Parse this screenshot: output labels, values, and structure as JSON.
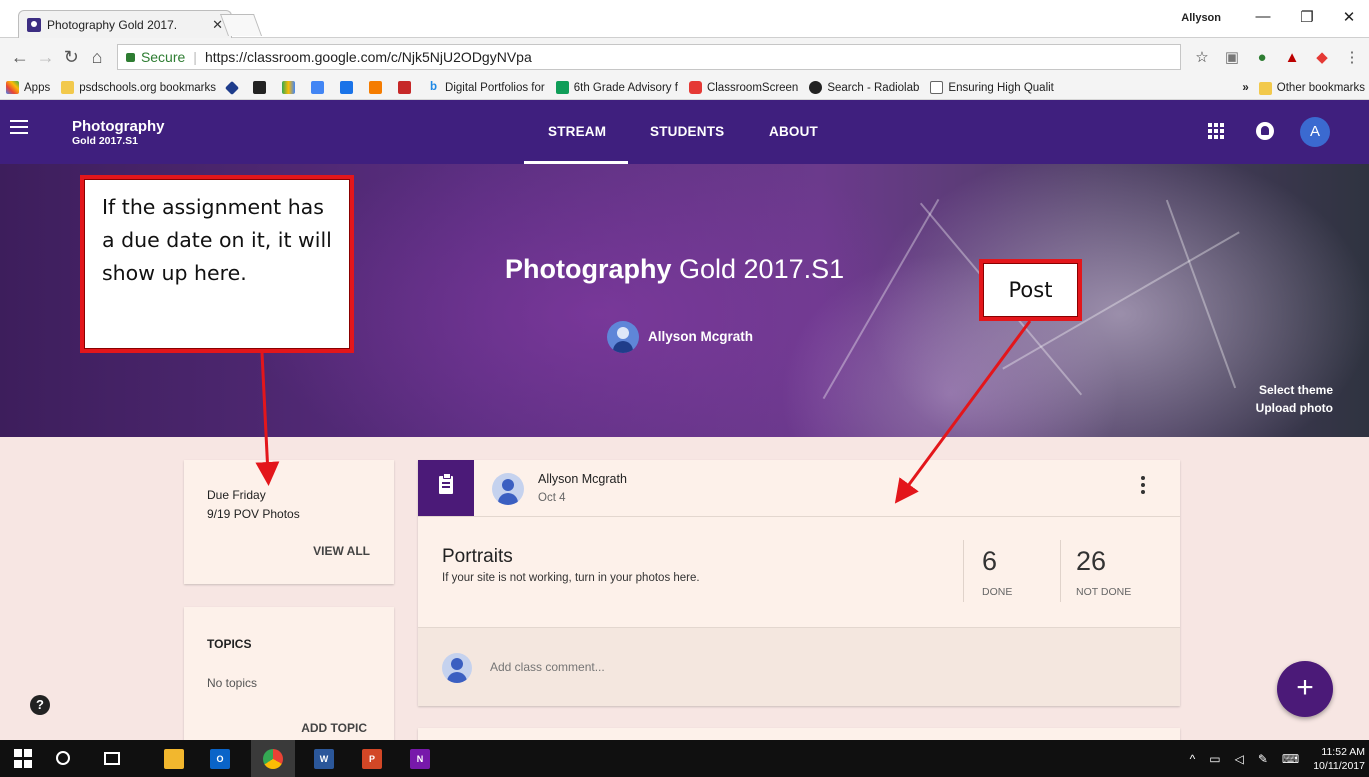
{
  "browser": {
    "tab_title": "Photography Gold 2017.",
    "user": "Allyson",
    "secure_label": "Secure",
    "url": "https://classroom.google.com/c/Njk5NjU2ODgyNVpa",
    "bookmarks": [
      "Apps",
      "psdschools.org bookmarks",
      "Digital Portfolios for",
      "6th Grade Advisory f",
      "ClassroomScreen",
      "Search - Radiolab",
      "Ensuring High Qualit"
    ],
    "more_bookmarks": "»",
    "other_bookmarks": "Other bookmarks"
  },
  "header": {
    "class_name": "Photography",
    "class_section": "Gold 2017.S1",
    "tabs": [
      "STREAM",
      "STUDENTS",
      "ABOUT"
    ],
    "active_tab": "STREAM",
    "avatar_initial": "A"
  },
  "banner": {
    "title_bold": "Photography",
    "title_rest": " Gold 2017.S1",
    "teacher": "Allyson Mcgrath",
    "select_theme": "Select theme",
    "upload_photo": "Upload photo"
  },
  "annotations": {
    "due_callout": "If the assignment has a due date on it, it will show up here.",
    "post_callout": "Post",
    "border_color": "#e3161b"
  },
  "upcoming": {
    "due_label": "Due Friday",
    "due_item": "9/19 POV Photos",
    "view_all": "VIEW ALL"
  },
  "topics": {
    "title": "TOPICS",
    "empty": "No topics",
    "add": "ADD TOPIC"
  },
  "post": {
    "author": "Allyson Mcgrath",
    "date": "Oct 4",
    "title": "Portraits",
    "description": "If your site is not working, turn in your photos here.",
    "done_count": "6",
    "done_label": "DONE",
    "not_done_count": "26",
    "not_done_label": "NOT DONE",
    "comment_placeholder": "Add class comment..."
  },
  "help_label": "?",
  "fab_label": "+",
  "taskbar": {
    "time": "11:52 AM",
    "date": "10/11/2017"
  },
  "colors": {
    "header": "#3f1f7e",
    "accent": "#4b1a78",
    "page_bg": "#f7e6e3",
    "card_bg": "#fdf1ea"
  }
}
